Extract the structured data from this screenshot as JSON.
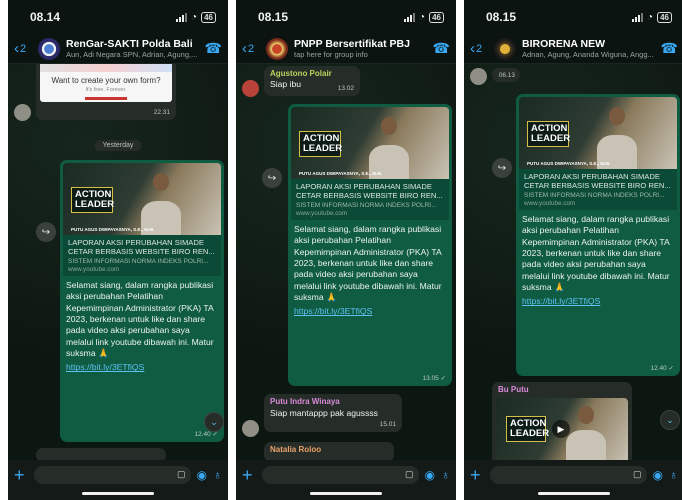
{
  "phones": [
    {
      "time": "08.14",
      "battery": "46",
      "back_count": "2",
      "group_name": "RenGar-SAKTI Polda Bali",
      "group_sub": "Aun, Adi Negara SPN, Adrian, Agung,...",
      "top_card": {
        "title": "Want to create your own form?",
        "sub": "It's free. Forever.",
        "time": "22.31"
      },
      "date_pill": "Yesterday",
      "post": {
        "thumb_title": "ACTION LEADER",
        "thumb_caption": "PUTU AGUS DWIPAYASNYA, S.E., M.M.",
        "link_title": "LAPORAN AKSI PERUBAHAN SIMADE CETAR BERBASIS WEBSITE BIRO REN...",
        "link_desc": "SISTEM INFORMASI NORMA INDEKS POLRI...",
        "link_domain": "www.youtube.com",
        "message": "Selamat siang, dalam rangka publikasi aksi perubahan Pelatihan Kepemimpinan Administrator (PKA) TA 2023, berkenan untuk like dan share pada video aksi perubahan saya melalui link youtube dibawah ini. Matur suksma 🙏",
        "link": "https://bit.ly/3ETfiQS",
        "time": "12.40 ✓"
      }
    },
    {
      "time": "08.15",
      "battery": "46",
      "back_count": "2",
      "group_name": "PNPP Bersertifikat PBJ",
      "group_sub": "tap here for group info",
      "top_msg": {
        "sender": "Agustono Polair",
        "text": "Siap ibu",
        "time": "13.02"
      },
      "post": {
        "thumb_title": "ACTION LEADER",
        "thumb_caption": "PUTU AGUS DWIPAYASNYA, S.E., M.M.",
        "link_title": "LAPORAN AKSI PERUBAHAN SIMADE CETAR BERBASIS WEBSITE BIRO REN...",
        "link_desc": "SISTEM INFORMASI NORMA INDEKS POLRI...",
        "link_domain": "www.youtube.com",
        "message": "Selamat siang, dalam rangka publikasi aksi perubahan Pelatihan Kepemimpinan Administrator (PKA) TA 2023, berkenan untuk like dan share pada video aksi perubahan saya melalui link youtube dibawah ini. Matur suksma 🙏",
        "link": "https://bit.ly/3ETfiQS",
        "time": "13.05 ✓"
      },
      "reply": {
        "sender": "Putu Indra Winaya",
        "text": "Siap mantappp pak agussss",
        "time": "15.01"
      },
      "next_sender": "Natalia Roloo"
    },
    {
      "time": "08.15",
      "battery": "46",
      "back_count": "2",
      "group_name": "BIRORENA NEW",
      "group_sub": "Adnan, Agung, Ananda Wiguna, Angg...",
      "top_time": "06.13",
      "post": {
        "thumb_title": "ACTION LEADER",
        "thumb_caption": "PUTU AGUS DWIPAYASNYA, S.E., M.M.",
        "link_title": "LAPORAN AKSI PERUBAHAN SIMADE CETAR BERBASIS WEBSITE BIRO REN...",
        "link_desc": "SISTEM INFORMASI NORMA INDEKS POLRI...",
        "link_domain": "www.youtube.com",
        "message": "Selamat siang, dalam rangka publikasi aksi perubahan Pelatihan Kepemimpinan Administrator (PKA) TA 2023, berkenan untuk like dan share pada video aksi perubahan saya melalui link youtube dibawah ini. Matur suksma 🙏",
        "link": "https://bit.ly/3ETfiQS",
        "time": "12.40 ✓"
      },
      "reply": {
        "sender": "Bu Putu",
        "thumb_title": "ACTION LEADER"
      }
    }
  ],
  "colors": {
    "outgoing": "#0f5c43",
    "incoming": "#262d29",
    "accent": "#3aa9f5",
    "link": "#5ec3f2"
  },
  "icons": [
    "back-chevron-icon",
    "add-call-icon",
    "forward-icon",
    "plus-icon",
    "sticker-icon",
    "camera-icon",
    "mic-icon",
    "scroll-down-icon"
  ]
}
